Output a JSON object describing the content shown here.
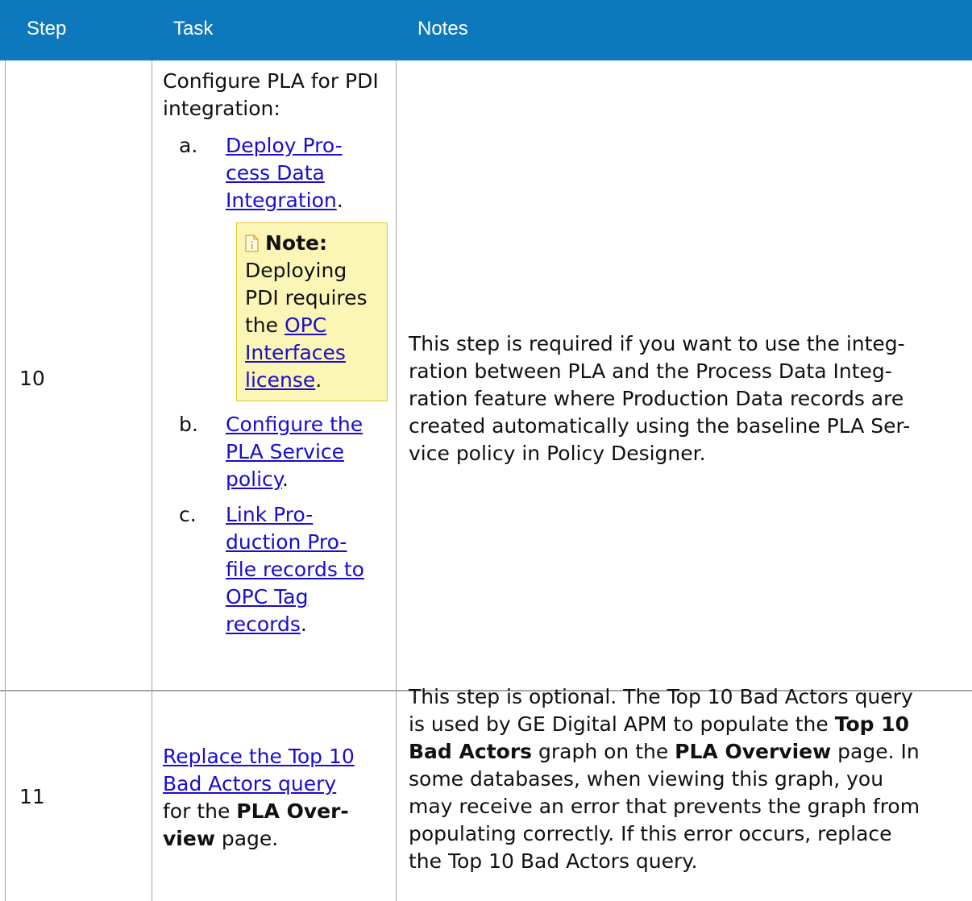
{
  "header": {
    "col_step": "Step",
    "col_task": "Task",
    "col_notes": "Notes"
  },
  "colors": {
    "header_bg": "#0e78bd",
    "link": "#1a0dcc",
    "note_bg": "#fcf6b6",
    "note_border": "#e3c42d"
  },
  "rows": [
    {
      "step": "10",
      "task_intro": "Configure PLA for PDI integration:",
      "items": [
        {
          "label": "a.",
          "link_lines": [
            "Deploy Pro-",
            "cess Data",
            "Integration"
          ],
          "suffix": "."
        },
        {
          "label": "b.",
          "link_lines": [
            "Configure the",
            "PLA Service",
            "policy"
          ],
          "suffix": "."
        },
        {
          "label": "c.",
          "link_lines": [
            "Link Pro-",
            "duction Pro-",
            "file records to",
            "OPC Tag",
            "records"
          ],
          "suffix": "."
        }
      ],
      "note": {
        "icon": "note-info-icon",
        "title": "Note:",
        "text_lines": [
          "Deploying",
          "PDI requires",
          "the "
        ],
        "link_lines": [
          "OPC",
          "Interfaces",
          "license"
        ],
        "suffix": "."
      },
      "notes_lines": [
        "This step is required if you want to use the integ-",
        "ration between PLA and the Process Data Integ-",
        "ration feature where Production Data records are",
        "created automatically using the baseline PLA Ser-",
        "vice policy in Policy Designer."
      ]
    },
    {
      "step": "11",
      "task_link_lines": [
        "Replace the Top 10",
        "Bad Actors query"
      ],
      "task_text": {
        "pre": "for the ",
        "bold1": "PLA Over-",
        "bold2": "view",
        "post": " page."
      },
      "notes": {
        "l1": "This step is optional. The Top 10 Bad Actors query",
        "l2_pre": "is used by GE Digital APM to populate the ",
        "l2_bold": "Top 10",
        "l3_bold1": "Bad Actors",
        "l3_mid": " graph on the ",
        "l3_bold2": "PLA Overview",
        "l3_post": " page. In",
        "l4": "some databases, when viewing this graph, you",
        "l5": "may receive an error that prevents the graph from",
        "l6": "populating correctly. If this error occurs, replace",
        "l7": "the Top 10 Bad Actors query."
      }
    }
  ]
}
